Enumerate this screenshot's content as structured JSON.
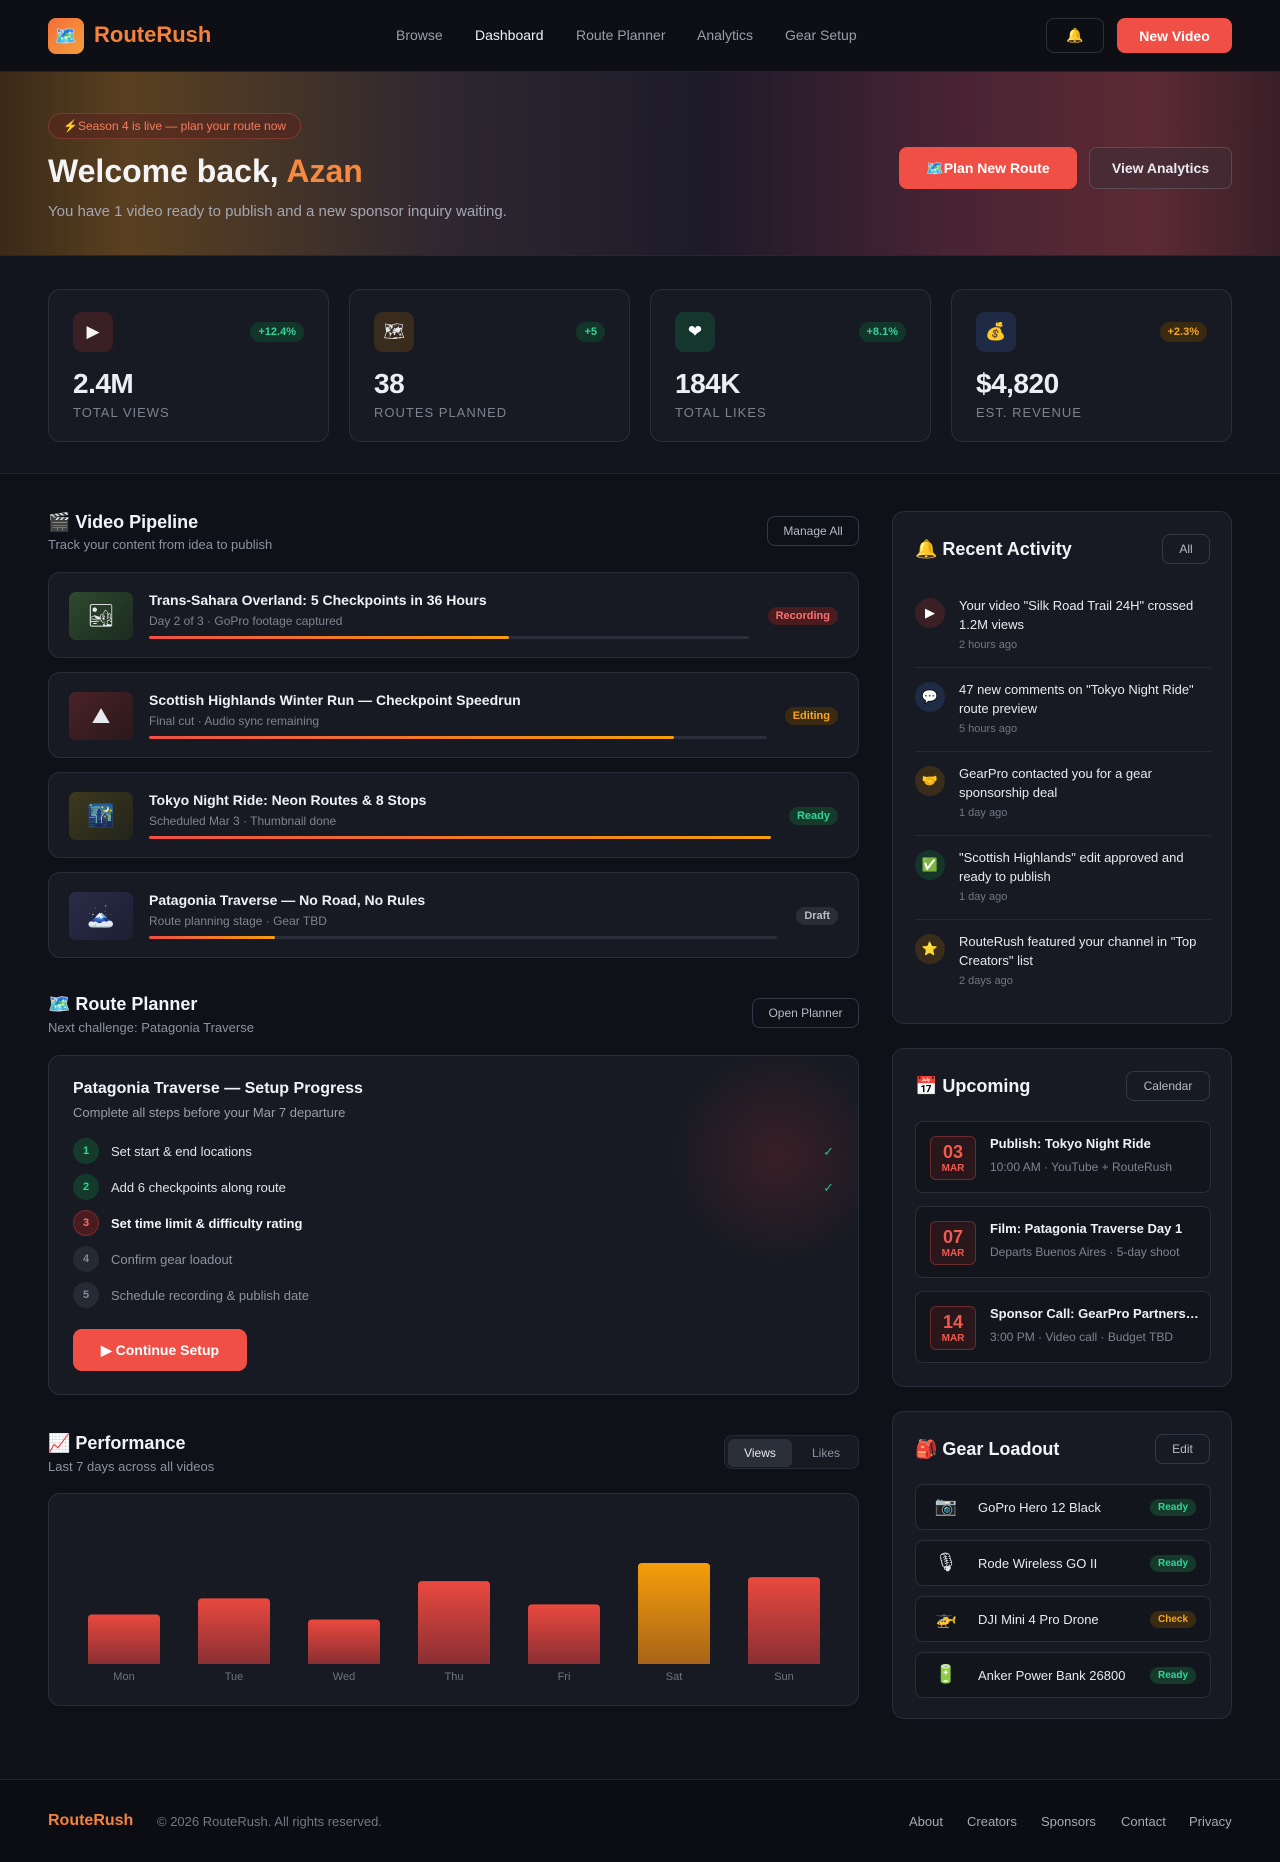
{
  "nav": {
    "logo_icon": "map-icon",
    "logo": "RouteRush",
    "links": [
      "Browse",
      "Dashboard",
      "Route Planner",
      "Analytics",
      "Gear Setup"
    ],
    "active": "Dashboard",
    "bell_icon": "🔔",
    "new_video": "New Video"
  },
  "hero": {
    "pill": "⚡Season 4 is live — plan your route now",
    "welcome": "Welcome back, ",
    "name": "Azan",
    "subtitle": "You have 1 video ready to publish and a new sponsor inquiry waiting.",
    "plan_btn": "🗺️Plan New Route",
    "analytics_btn": "View Analytics"
  },
  "stats": [
    {
      "icon": "▶",
      "change": "+12.4%",
      "value": "2.4M",
      "label": "TOTAL VIEWS"
    },
    {
      "icon": "🗺",
      "change": "+5",
      "value": "38",
      "label": "ROUTES PLANNED"
    },
    {
      "icon": "❤",
      "change": "+8.1%",
      "value": "184K",
      "label": "TOTAL LIKES"
    },
    {
      "icon": "💰",
      "change": "+2.3%",
      "value": "$4,820",
      "label": "EST. REVENUE"
    }
  ],
  "pipeline": {
    "title": "🎬 Video Pipeline",
    "subtitle": "Track your content from idea to publish",
    "manage": "Manage All",
    "items": [
      {
        "thumb": "🏜",
        "title": "Trans-Sahara Overland: 5 Checkpoints in 36 Hours",
        "sub": "Day 2 of 3 · GoPro footage captured",
        "status": "Recording",
        "progress": 0.6
      },
      {
        "thumb": "⛰",
        "title": "Scottish Highlands Winter Run — Checkpoint Speedrun",
        "sub": "Final cut · Audio sync remaining",
        "status": "Editing",
        "progress": 0.85
      },
      {
        "thumb": "🌃",
        "title": "Tokyo Night Ride: Neon Routes & 8 Stops",
        "sub": "Scheduled Mar 3 · Thumbnail done",
        "status": "Ready",
        "progress": 1.0
      },
      {
        "thumb": "🗻",
        "title": "Patagonia Traverse — No Road, No Rules",
        "sub": "Route planning stage · Gear TBD",
        "status": "Draft",
        "progress": 0.2
      }
    ]
  },
  "planner": {
    "title": "🗺️ Route Planner",
    "subtitle": "Next challenge: Patagonia Traverse",
    "open": "Open Planner",
    "card_title": "Patagonia Traverse — Setup Progress",
    "card_sub": "Complete all steps before your Mar 7 departure",
    "steps": [
      {
        "num": "1",
        "text": "Set start & end locations",
        "state": "done",
        "check": "✓"
      },
      {
        "num": "2",
        "text": "Add 6 checkpoints along route",
        "state": "done",
        "check": "✓"
      },
      {
        "num": "3",
        "text": "Set time limit & difficulty rating",
        "state": "current",
        "check": ""
      },
      {
        "num": "4",
        "text": "Confirm gear loadout",
        "state": "todo",
        "check": ""
      },
      {
        "num": "5",
        "text": "Schedule recording & publish date",
        "state": "todo",
        "check": ""
      }
    ],
    "continue": "▶ Continue Setup"
  },
  "performance": {
    "title": "📈 Performance",
    "subtitle": "Last 7 days across all videos",
    "toggle": [
      "Views",
      "Likes"
    ]
  },
  "chart_data": {
    "type": "bar",
    "categories": [
      "Mon",
      "Tue",
      "Wed",
      "Thu",
      "Fri",
      "Sat",
      "Sun"
    ],
    "values": [
      49,
      65,
      44,
      82,
      59,
      100,
      86
    ],
    "highlight": "Sat",
    "colors": {
      "bar": "#e9493f",
      "highlight": "#f59e0b"
    },
    "ylim": [
      0,
      100
    ],
    "grid": false
  },
  "activity": {
    "title": "🔔 Recent Activity",
    "all": "All",
    "items": [
      {
        "icon": "▶",
        "text": "Your video \"Silk Road Trail 24H\" crossed 1.2M views",
        "time": "2 hours ago"
      },
      {
        "icon": "💬",
        "text": "47 new comments on \"Tokyo Night Ride\" route preview",
        "time": "5 hours ago"
      },
      {
        "icon": "🤝",
        "text": "GearPro contacted you for a gear sponsorship deal",
        "time": "1 day ago"
      },
      {
        "icon": "✅",
        "text": "\"Scottish Highlands\" edit approved and ready to publish",
        "time": "1 day ago"
      },
      {
        "icon": "⭐",
        "text": "RouteRush featured your channel in \"Top Creators\" list",
        "time": "2 days ago"
      }
    ]
  },
  "upcoming": {
    "title": "📅 Upcoming",
    "calendar": "Calendar",
    "items": [
      {
        "day": "03",
        "month": "MAR",
        "title": "Publish: Tokyo Night Ride",
        "sub": "10:00 AM · YouTube + RouteRush"
      },
      {
        "day": "07",
        "month": "MAR",
        "title": "Film: Patagonia Traverse Day 1",
        "sub": "Departs Buenos Aires · 5-day shoot"
      },
      {
        "day": "14",
        "month": "MAR",
        "title": "Sponsor Call: GearPro Partnership",
        "sub": "3:00 PM · Video call · Budget TBD"
      }
    ]
  },
  "gear": {
    "title": "🎒 Gear Loadout",
    "edit": "Edit",
    "items": [
      {
        "icon": "📷",
        "name": "GoPro Hero 12 Black",
        "status": "Ready"
      },
      {
        "icon": "🎙",
        "name": "Rode Wireless GO II",
        "status": "Ready"
      },
      {
        "icon": "🚁",
        "name": "DJI Mini 4 Pro Drone",
        "status": "Check"
      },
      {
        "icon": "🔋",
        "name": "Anker Power Bank 26800",
        "status": "Ready"
      }
    ]
  },
  "footer": {
    "logo": "RouteRush",
    "copy": "© 2026 RouteRush. All rights reserved.",
    "links": [
      "About",
      "Creators",
      "Sponsors",
      "Contact",
      "Privacy"
    ]
  }
}
